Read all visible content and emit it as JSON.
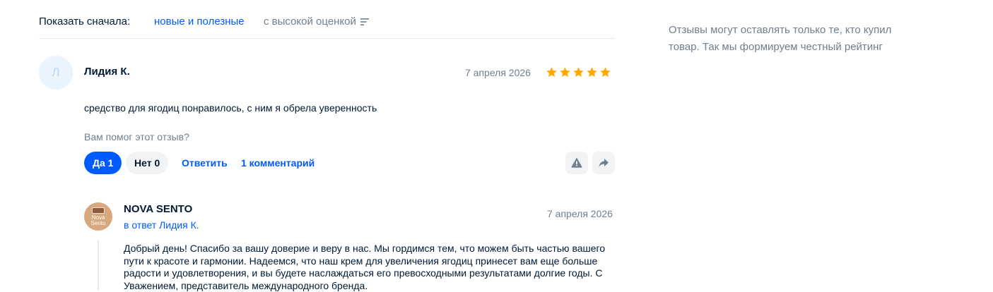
{
  "sort": {
    "label": "Показать сначала:",
    "options": [
      {
        "label": "новые и полезные",
        "active": true
      },
      {
        "label": "с высокой оценкой",
        "active": false
      }
    ],
    "icon": "sort-icon"
  },
  "review": {
    "avatar_letter": "Л",
    "author": "Лидия К.",
    "date": "7 апреля 2026",
    "rating": 5,
    "max_rating": 5,
    "text": "средство для ягодиц понравилось, с ним я обрела уверенность",
    "helpful_question": "Вам помог этот отзыв?",
    "yes_label": "Да 1",
    "no_label": "Нет 0",
    "reply_label": "Ответить",
    "comments_label": "1 комментарий",
    "icons": [
      "report-icon",
      "share-icon"
    ]
  },
  "seller_reply": {
    "name": "NOVA SENTO",
    "avatar_logo_text": "Nova Sento",
    "reply_to": "в ответ Лидия К.",
    "date": "7 апреля 2026",
    "text": "Добрый день! Спасибо за вашу доверие и веру в нас. Мы гордимся тем, что можем быть частью вашего пути к красоте и гармонии. Надеемся, что наш крем для увеличения ягодиц принесет вам еще больше радости и удовлетворения, и вы будете наслаждаться его превосходными результатами долгие годы. С Уважением, представитель международного бренда."
  },
  "side_note": {
    "text": "Отзывы могут оставлять только те, кто купил товар. Так мы формируем честный рейтинг"
  },
  "colors": {
    "accent": "#005bff",
    "star": "#ffa800",
    "muted": "#707f8d",
    "text": "#001a34"
  }
}
